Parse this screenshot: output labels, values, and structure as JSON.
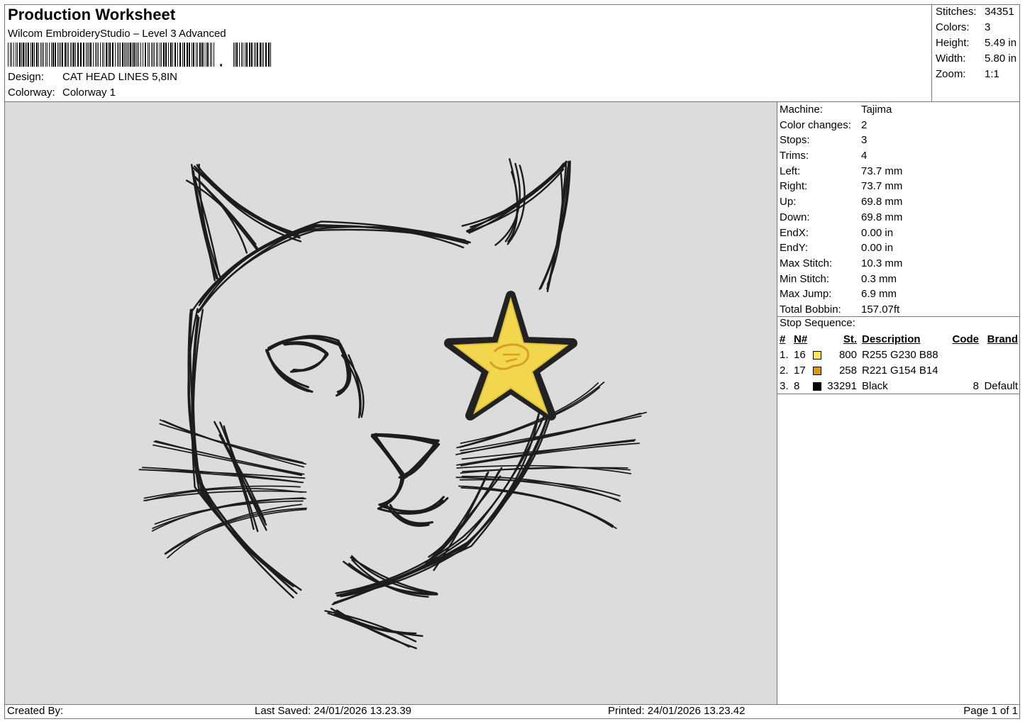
{
  "header": {
    "title": "Production Worksheet",
    "software": "Wilcom EmbroideryStudio – Level 3 Advanced",
    "design_label": "Design:",
    "design_value": "CAT HEAD LINES 5,8IN",
    "colorway_label": "Colorway:",
    "colorway_value": "Colorway 1"
  },
  "summary": [
    {
      "label": "Stitches:",
      "value": "34351"
    },
    {
      "label": "Colors:",
      "value": "3"
    },
    {
      "label": "Height:",
      "value": "5.49 in"
    },
    {
      "label": "Width:",
      "value": "5.80 in"
    },
    {
      "label": "Zoom:",
      "value": "1:1"
    }
  ],
  "details": [
    {
      "label": "Machine:",
      "value": "Tajima"
    },
    {
      "label": "Color changes:",
      "value": "2"
    },
    {
      "label": "Stops:",
      "value": "3"
    },
    {
      "label": "Trims:",
      "value": "4"
    },
    {
      "label": "Left:",
      "value": "73.7 mm"
    },
    {
      "label": "Right:",
      "value": "73.7 mm"
    },
    {
      "label": "Up:",
      "value": "69.8 mm"
    },
    {
      "label": "Down:",
      "value": "69.8 mm"
    },
    {
      "label": "EndX:",
      "value": "0.00 in"
    },
    {
      "label": "EndY:",
      "value": "0.00 in"
    },
    {
      "label": "Max Stitch:",
      "value": "10.3 mm"
    },
    {
      "label": "Min Stitch:",
      "value": "0.3 mm"
    },
    {
      "label": "Max Jump:",
      "value": "6.9 mm"
    },
    {
      "label": "Total Bobbin:",
      "value": "157.07ft"
    }
  ],
  "stop_sequence": {
    "title": "Stop Sequence:",
    "headers": {
      "num": "#",
      "needle": "N#",
      "stitches": "St.",
      "description": "Description",
      "code": "Code",
      "brand": "Brand"
    },
    "rows": [
      {
        "num": "1.",
        "needle": "16",
        "color": "#FFE658",
        "stitches": "800",
        "description": "R255 G230 B88",
        "code": "",
        "brand": ""
      },
      {
        "num": "2.",
        "needle": "17",
        "color": "#DD9A0E",
        "stitches": "258",
        "description": "R221 G154 B14",
        "code": "",
        "brand": ""
      },
      {
        "num": "3.",
        "needle": "8",
        "color": "#000000",
        "stitches": "33291",
        "description": "Black",
        "code": "8",
        "brand": "Default"
      }
    ]
  },
  "footer": {
    "created_by": "Created By:",
    "last_saved": "Last Saved: 24/01/2026 13.23.39",
    "printed": "Printed: 24/01/2026 13.23.42",
    "page": "Page 1 of 1"
  }
}
